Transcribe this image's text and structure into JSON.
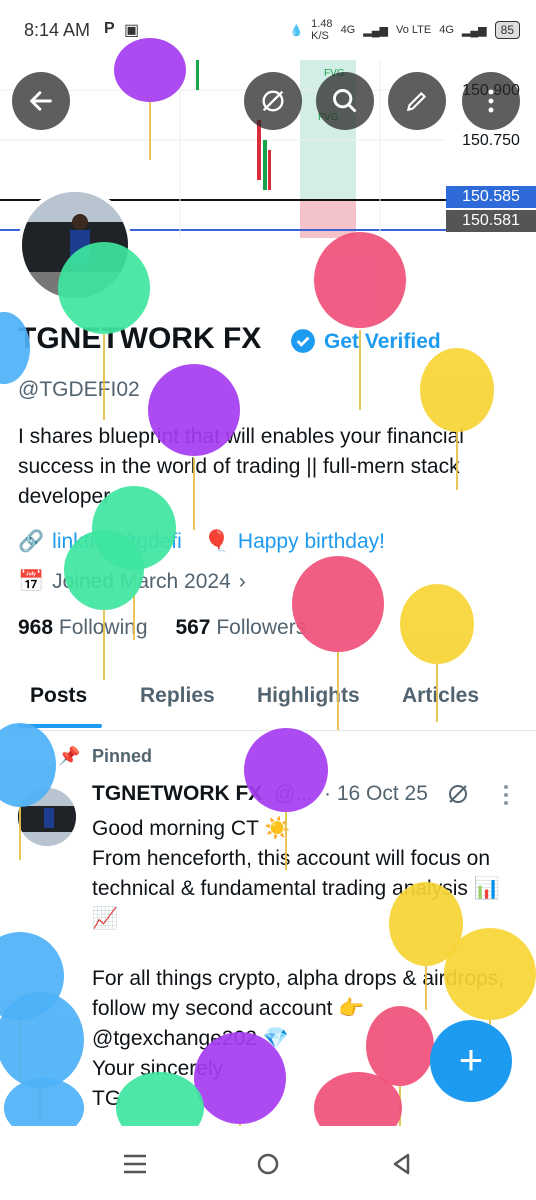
{
  "status": {
    "time": "8:14 AM",
    "speed": "1.48",
    "speed_unit": "K/S",
    "net1": "4G",
    "volte": "Vo LTE",
    "net2": "4G",
    "battery": "85"
  },
  "chart": {
    "prices": [
      "150.900",
      "150.750",
      "150.585",
      "150.581"
    ],
    "labels": [
      "FVG",
      "FVG"
    ]
  },
  "profile": {
    "name": "TGNETWORK FX",
    "get_verified": "Get Verified",
    "handle": "@TGDEFI02",
    "bio": "I shares blueprint that will enables your financial success in the world of trading || full-mern stack developer",
    "link": "linktr.ee/tgdefi",
    "birthday": "Happy birthday!",
    "joined": "Joined March 2024",
    "following_count": "968",
    "following_label": "Following",
    "followers_count": "567",
    "followers_label": "Followers"
  },
  "tabs": [
    "Posts",
    "Replies",
    "Highlights",
    "Articles"
  ],
  "post": {
    "pinned_label": "Pinned",
    "author": "TGNETWORK FX",
    "handle": "@...",
    "date": "· 16 Oct 25",
    "body": "Good morning CT ☀️\nFrom henceforth, this account will focus on technical & fundamental trading analysis 📊📈\n\nFor all things crypto, alpha drops & airdrops, follow my second account 👉 @tgexchange202 💎\nYour sincerely\nTG"
  },
  "fab_label": "+",
  "colors": {
    "accent": "#1d9bf0",
    "balloon_pink": "#f0507a",
    "balloon_green": "#3ee6a0",
    "balloon_purple": "#a43cf0",
    "balloon_yellow": "#f7d535",
    "balloon_blue": "#4db1f7"
  }
}
